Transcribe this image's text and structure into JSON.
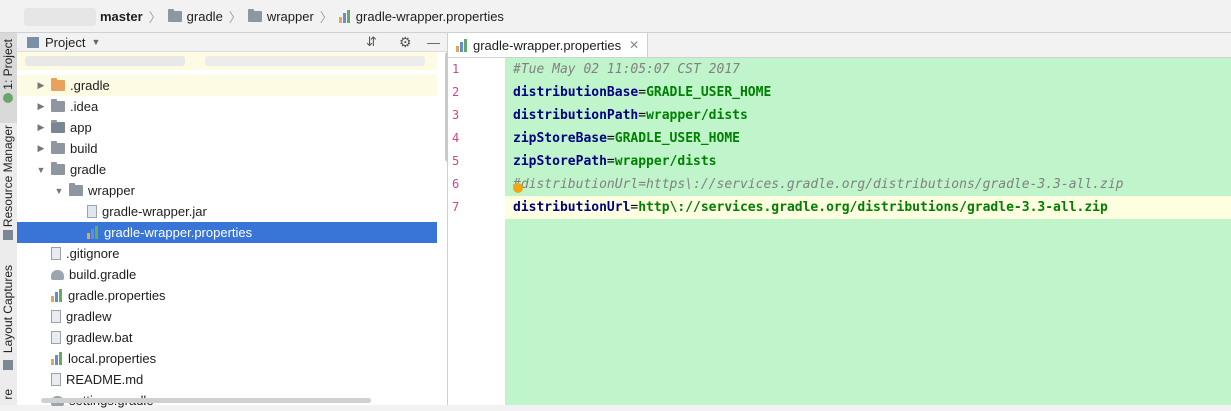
{
  "breadcrumb": {
    "items": [
      {
        "label": "master",
        "icon": "git-branch-icon"
      },
      {
        "label": "gradle",
        "icon": "folder-icon"
      },
      {
        "label": "wrapper",
        "icon": "folder-icon"
      },
      {
        "label": "gradle-wrapper.properties",
        "icon": "properties-file-icon"
      }
    ]
  },
  "tool_strip": {
    "items": [
      "1: Project",
      "Resource Manager",
      "Layout Captures",
      "re"
    ]
  },
  "project_panel": {
    "title": "Project",
    "tree": [
      {
        "label": ".gradle",
        "icon": "folder-orange-icon",
        "indent": 1,
        "expandable": true,
        "expanded": false
      },
      {
        "label": ".idea",
        "icon": "folder-icon",
        "indent": 1,
        "expandable": true,
        "expanded": false
      },
      {
        "label": "app",
        "icon": "module-folder-icon",
        "indent": 1,
        "expandable": true,
        "expanded": false
      },
      {
        "label": "build",
        "icon": "folder-icon",
        "indent": 1,
        "expandable": true,
        "expanded": false
      },
      {
        "label": "gradle",
        "icon": "folder-icon",
        "indent": 1,
        "expandable": true,
        "expanded": true
      },
      {
        "label": "wrapper",
        "icon": "folder-icon",
        "indent": 2,
        "expandable": true,
        "expanded": true
      },
      {
        "label": "gradle-wrapper.jar",
        "icon": "jar-file-icon",
        "indent": 3,
        "expandable": false
      },
      {
        "label": "gradle-wrapper.properties",
        "icon": "properties-file-icon",
        "indent": 3,
        "expandable": false,
        "selected": true
      },
      {
        "label": ".gitignore",
        "icon": "text-file-icon",
        "indent": 1,
        "expandable": false
      },
      {
        "label": "build.gradle",
        "icon": "gradle-file-icon",
        "indent": 1,
        "expandable": false
      },
      {
        "label": "gradle.properties",
        "icon": "properties-file-icon",
        "indent": 1,
        "expandable": false
      },
      {
        "label": "gradlew",
        "icon": "text-file-icon",
        "indent": 1,
        "expandable": false
      },
      {
        "label": "gradlew.bat",
        "icon": "text-file-icon",
        "indent": 1,
        "expandable": false
      },
      {
        "label": "local.properties",
        "icon": "properties-file-icon",
        "indent": 1,
        "expandable": false
      },
      {
        "label": "README.md",
        "icon": "text-file-icon",
        "indent": 1,
        "expandable": false
      },
      {
        "label": "settings.gradle",
        "icon": "gradle-file-icon",
        "indent": 1,
        "expandable": false
      }
    ]
  },
  "editor": {
    "tab_label": "gradle-wrapper.properties",
    "lines": [
      {
        "num": "1",
        "comment": "#Tue May 02 11:05:07 CST 2017"
      },
      {
        "num": "2",
        "key": "distributionBase",
        "eq": "=",
        "value": "GRADLE_USER_HOME"
      },
      {
        "num": "3",
        "key": "distributionPath",
        "eq": "=",
        "value": "wrapper/dists"
      },
      {
        "num": "4",
        "key": "zipStoreBase",
        "eq": "=",
        "value": "GRADLE_USER_HOME"
      },
      {
        "num": "5",
        "key": "zipStorePath",
        "eq": "=",
        "value": "wrapper/dists"
      },
      {
        "num": "6",
        "comment": "#distributionUrl=https\\://services.gradle.org/distributions/gradle-3.3-all.zip"
      },
      {
        "num": "7",
        "key": "distributionUrl",
        "eq": "=",
        "value": "http\\://services.gradle.org/distributions/gradle-3.3-all.zip",
        "current": true
      }
    ]
  },
  "colors": {
    "selection": "#3875d7",
    "editor_bg": "#c0f5cc",
    "current_line": "#fefee0",
    "line_numbers": "#c44a8b"
  }
}
